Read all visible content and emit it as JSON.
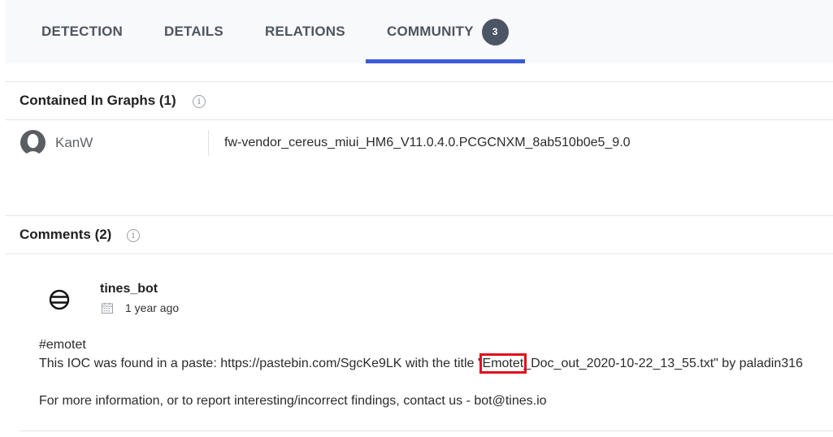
{
  "tabs": [
    {
      "label": "DETECTION"
    },
    {
      "label": "DETAILS"
    },
    {
      "label": "RELATIONS"
    },
    {
      "label": "COMMUNITY",
      "badge": "3",
      "active": true
    }
  ],
  "graphs": {
    "title": "Contained In Graphs (1)",
    "items": [
      {
        "author": "KanW",
        "name": "fw-vendor_cereus_miui_HM6_V11.0.4.0.PCGCNXM_8ab510b0e5_9.0"
      }
    ]
  },
  "comments": {
    "title": "Comments (2)",
    "items": [
      {
        "author": "tines_bot",
        "date": "1 year ago",
        "tag": "#emotet",
        "line1_before": "This IOC was found in a paste: https://pastebin.com/SgcKe9LK with the title \"",
        "line1_highlight": "Emotet",
        "line1_after": "_Doc_out_2020-10-22_13_55.txt\" by paladin316",
        "line2": "For more information, or to report interesting/incorrect findings, contact us - bot@tines.io"
      }
    ]
  },
  "colors": {
    "accent": "#3b5bdb",
    "highlight_box": "#e0101c"
  }
}
